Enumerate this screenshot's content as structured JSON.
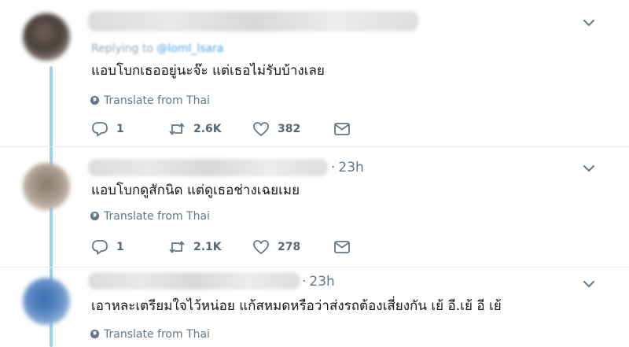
{
  "tweets": [
    {
      "replying_prefix": "Replying to",
      "replying_handle": "@loml_lsara",
      "time": "",
      "text": "แอบโบกเธออยู่นะจ๊ะ แต่เธอไม่รับบ้างเลย",
      "translate": "Translate from Thai",
      "replies": "1",
      "retweets": "2.6K",
      "likes": "382"
    },
    {
      "time": "23h",
      "text": "แอบโบกดูสักนิด แต่ดูเธอช่างเฉยเมย",
      "translate": "Translate from Thai",
      "replies": "1",
      "retweets": "2.1K",
      "likes": "278"
    },
    {
      "time": "23h",
      "text": "เอาหละเตรียมใจไว้หน่อย แก้สหมดหรือว่าส่งรถต้องเสี่ยงกัน เย้ อี.เย้ อี เย้",
      "translate": "Translate from Thai"
    }
  ],
  "icons": {
    "reply": "reply-icon",
    "retweet": "retweet-icon",
    "like": "heart-icon",
    "dm": "envelope-icon",
    "more": "chevron-down-icon",
    "translate": "globe-icon"
  },
  "colors": {
    "thread_line": "#9ed1ef",
    "text_primary": "#14171a",
    "text_secondary": "#657786",
    "divider": "#e6ecf0"
  }
}
